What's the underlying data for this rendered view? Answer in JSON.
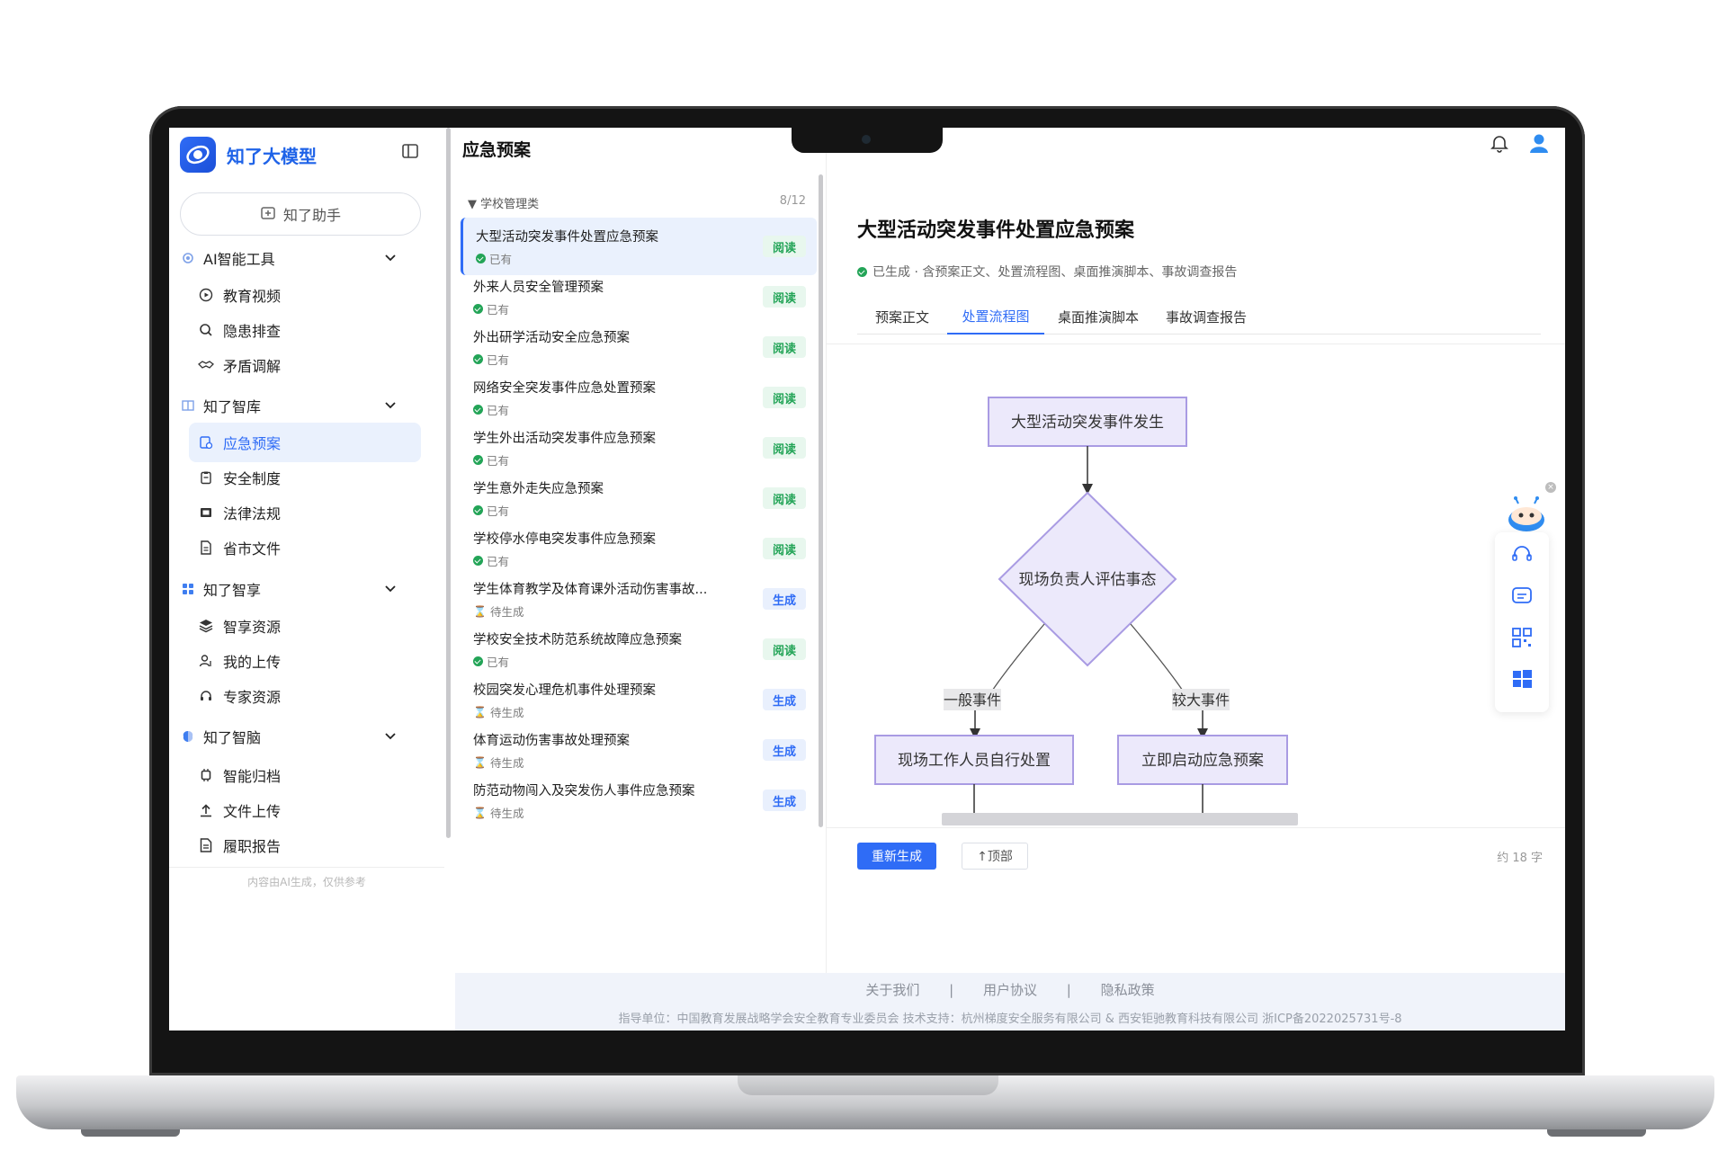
{
  "app": {
    "name": "知了大模型"
  },
  "sidebar": {
    "assistant_label": "知了助手",
    "groups": [
      {
        "label": "AI智能工具",
        "items": [
          {
            "label": "教育视频",
            "icon": "play-circle-icon"
          },
          {
            "label": "隐患排查",
            "icon": "search-icon"
          },
          {
            "label": "矛盾调解",
            "icon": "handshake-icon"
          }
        ]
      },
      {
        "label": "知了智库",
        "items": [
          {
            "label": "应急预案",
            "icon": "emergency-doc-icon",
            "active": true
          },
          {
            "label": "安全制度",
            "icon": "clipboard-icon"
          },
          {
            "label": "法律法规",
            "icon": "law-book-icon"
          },
          {
            "label": "省市文件",
            "icon": "file-icon"
          }
        ]
      },
      {
        "label": "知了智享",
        "items": [
          {
            "label": "智享资源",
            "icon": "layers-icon"
          },
          {
            "label": "我的上传",
            "icon": "user-upload-icon"
          },
          {
            "label": "专家资源",
            "icon": "headset-icon"
          }
        ]
      },
      {
        "label": "知了智脑",
        "items": [
          {
            "label": "智能归档",
            "icon": "chip-icon"
          },
          {
            "label": "文件上传",
            "icon": "upload-icon"
          },
          {
            "label": "履职报告",
            "icon": "report-icon"
          }
        ]
      }
    ],
    "footnote": "内容由AI生成，仅供参考"
  },
  "list": {
    "title": "应急预案",
    "category": "学校管理类",
    "count": "8/12",
    "items": [
      {
        "title": "大型活动突发事件处置应急预案",
        "status": "已有",
        "state": "ok",
        "action": "阅读",
        "selected": true
      },
      {
        "title": "外来人员安全管理预案",
        "status": "已有",
        "state": "ok",
        "action": "阅读"
      },
      {
        "title": "外出研学活动安全应急预案",
        "status": "已有",
        "state": "ok",
        "action": "阅读"
      },
      {
        "title": "网络安全突发事件应急处置预案",
        "status": "已有",
        "state": "ok",
        "action": "阅读"
      },
      {
        "title": "学生外出活动突发事件应急预案",
        "status": "已有",
        "state": "ok",
        "action": "阅读"
      },
      {
        "title": "学生意外走失应急预案",
        "status": "已有",
        "state": "ok",
        "action": "阅读"
      },
      {
        "title": "学校停水停电突发事件应急预案",
        "status": "已有",
        "state": "ok",
        "action": "阅读"
      },
      {
        "title": "学生体育教学及体育课外活动伤害事故...",
        "status": "待生成",
        "state": "pending",
        "action": "生成"
      },
      {
        "title": "学校安全技术防范系统故障应急预案",
        "status": "已有",
        "state": "ok",
        "action": "阅读"
      },
      {
        "title": "校园突发心理危机事件处理预案",
        "status": "待生成",
        "state": "pending",
        "action": "生成"
      },
      {
        "title": "体育运动伤害事故处理预案",
        "status": "待生成",
        "state": "pending",
        "action": "生成"
      },
      {
        "title": "防范动物闯入及突发伤人事件应急预案",
        "status": "待生成",
        "state": "pending",
        "action": "生成"
      }
    ]
  },
  "detail": {
    "title": "大型活动突发事件处置应急预案",
    "subtitle": "已生成 · 含预案正文、处置流程图、桌面推演脚本、事故调查报告",
    "tabs": [
      "预案正文",
      "处置流程图",
      "桌面推演脚本",
      "事故调查报告"
    ],
    "active_tab": "处置流程图",
    "flowchart": {
      "start": "大型活动突发事件发生",
      "decision": "现场负责人评估事态",
      "branch_left_label": "一般事件",
      "branch_right_label": "较大事件",
      "left_action": "现场工作人员自行处置",
      "right_action": "立即启动应急预案"
    },
    "regen_label": "重新生成",
    "top_label": "↑顶部",
    "word_count": "约 18 字"
  },
  "footer": {
    "links": [
      "关于我们",
      "用户协议",
      "隐私政策"
    ],
    "credits": "指导单位：中国教育发展战略学会安全教育专业委员会   技术支持：杭州梯度安全服务有限公司 & 西安钜驰教育科技有限公司   浙ICP备2022025731号-8"
  },
  "colors": {
    "accent": "#2f6cf6",
    "ok": "#23a457",
    "flow_fill": "#ece9fb",
    "flow_stroke": "#a99be3"
  }
}
